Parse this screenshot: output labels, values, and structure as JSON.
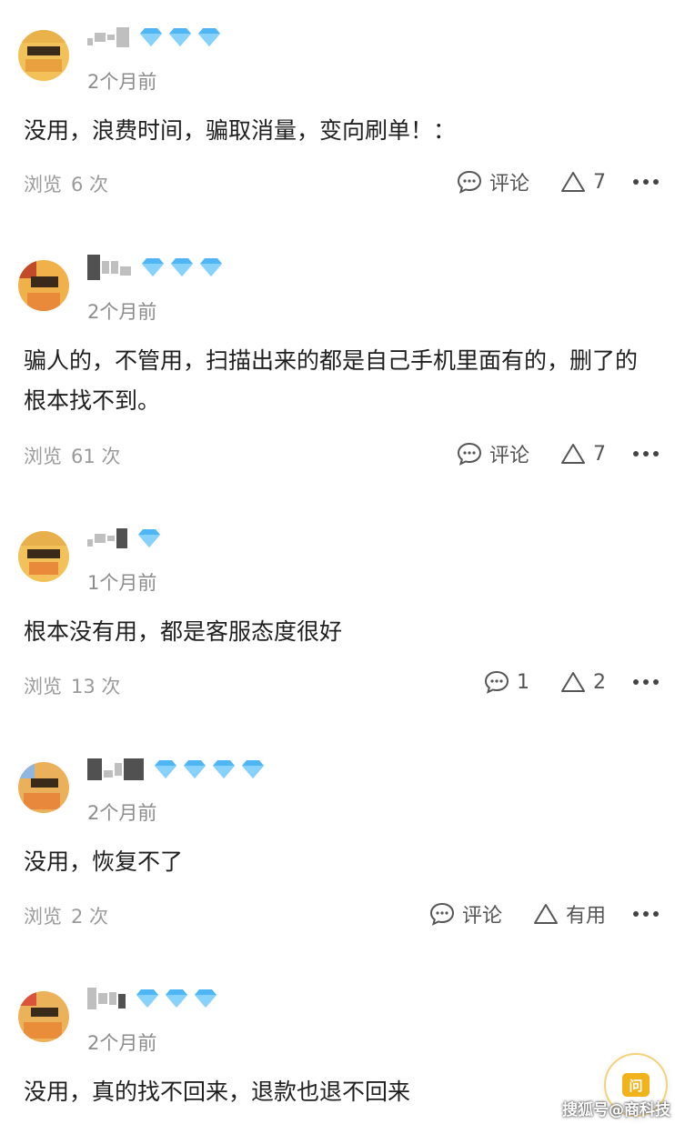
{
  "colors": {
    "gem": "#4fb6f5",
    "avatar": "#f2c15a",
    "float_accent": "#f1b21c"
  },
  "comments": [
    {
      "time": "2个月前",
      "text": "没用，浪费时间，骗取消量，变向刷单！：",
      "views_label": "浏览",
      "views": "6 次",
      "reply_label": "评论",
      "like_label": "7",
      "gems": 3
    },
    {
      "time": "2个月前",
      "text": "骗人的，不管用，扫描出来的都是自己手机里面有的，删了的根本找不到。",
      "views_label": "浏览",
      "views": "61 次",
      "reply_label": "评论",
      "like_label": "7",
      "gems": 3
    },
    {
      "time": "1个月前",
      "text": "根本没有用，都是客服态度很好",
      "views_label": "浏览",
      "views": "13 次",
      "reply_label": "1",
      "like_label": "2",
      "gems": 1
    },
    {
      "time": "2个月前",
      "text": "没用，恢复不了",
      "views_label": "浏览",
      "views": "2 次",
      "reply_label": "评论",
      "like_label": "有用",
      "gems": 4
    },
    {
      "time": "2个月前",
      "text": "没用，真的找不回来，退款也退不回来",
      "gems": 3
    }
  ],
  "float_button": {
    "label": "问"
  },
  "watermark": "搜狐号@商科技"
}
